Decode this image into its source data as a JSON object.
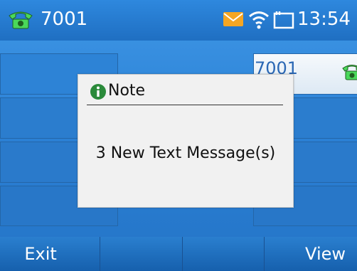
{
  "status_bar": {
    "account": "7001",
    "time": "13:54",
    "icons": [
      "phone-icon",
      "mail-icon",
      "wifi-icon",
      "screen-icon"
    ],
    "mail_color": "#f5a623",
    "phone_icon_color": "#4ad85a"
  },
  "line_keys": {
    "right_1_label": "7001"
  },
  "dialog": {
    "title": "Note",
    "icon": "info-icon",
    "message": "3 New Text Message(s)"
  },
  "softkeys": {
    "key1": "Exit",
    "key2": "",
    "key3": "",
    "key4": "View"
  }
}
